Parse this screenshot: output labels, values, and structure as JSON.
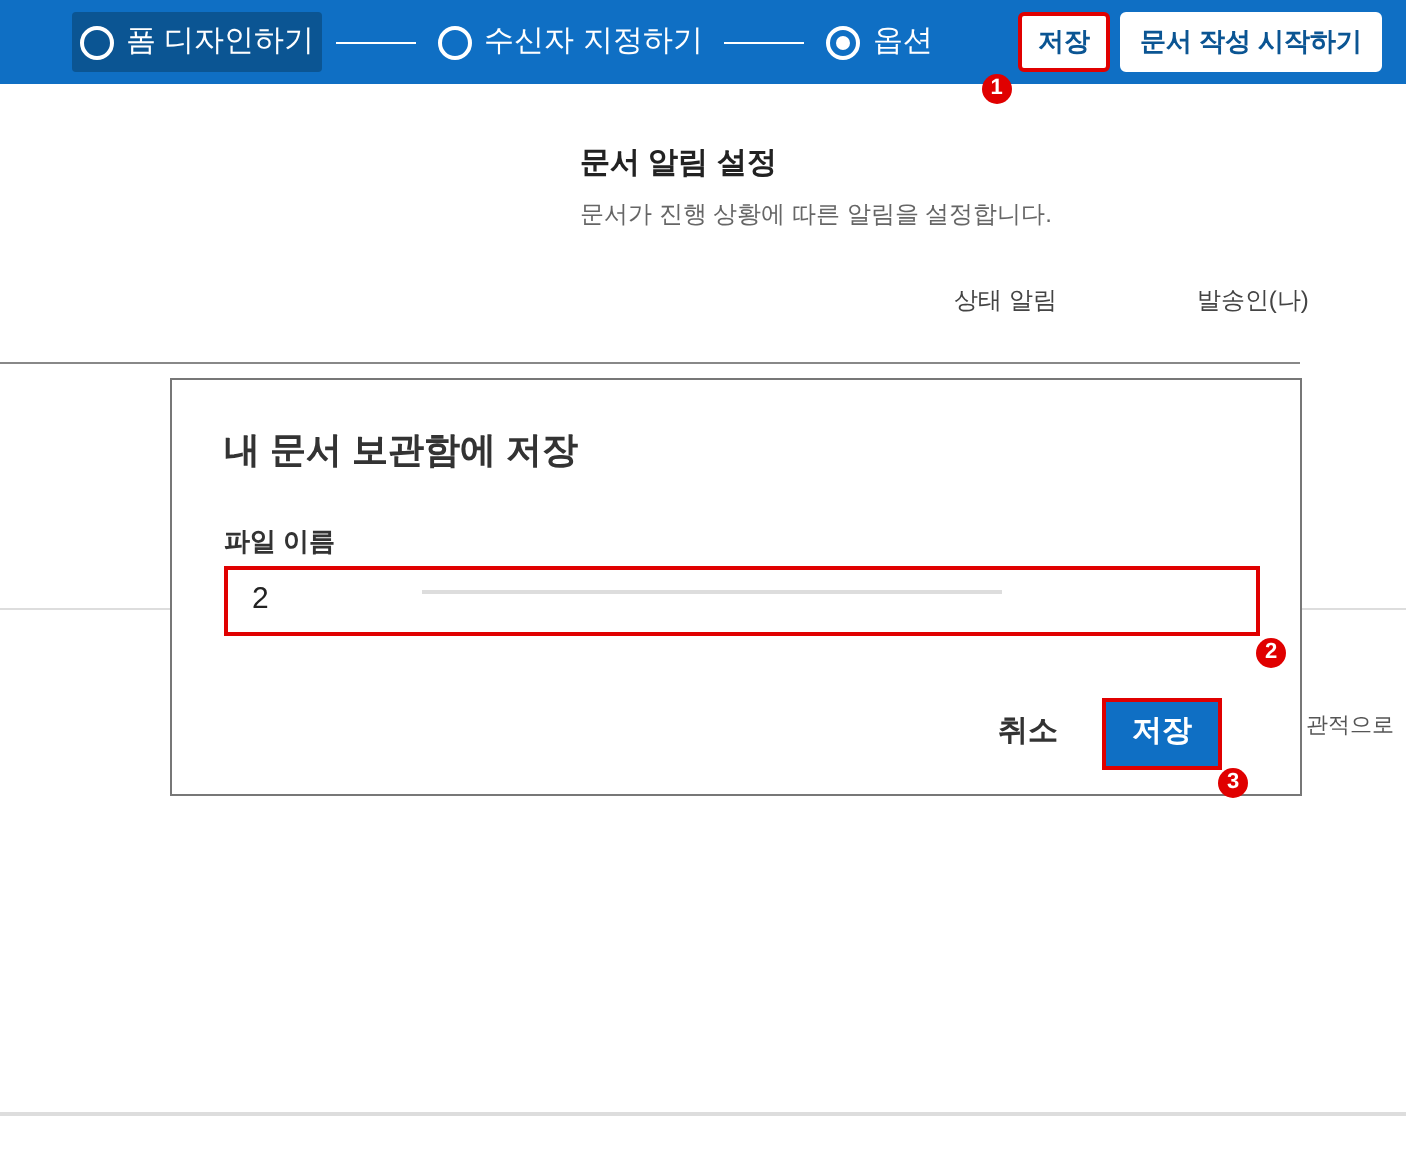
{
  "steps": [
    {
      "label": "폼 디자인하기",
      "checked": false,
      "highlighted": true
    },
    {
      "label": "수신자 지정하기",
      "checked": false,
      "highlighted": false
    },
    {
      "label": "옵션",
      "checked": true,
      "highlighted": false
    }
  ],
  "header_buttons": [
    {
      "label": "저장",
      "annotated": true,
      "badge": "1"
    },
    {
      "label": "문서 작성 시작하기",
      "annotated": false
    }
  ],
  "section": {
    "title": "문서 알림 설정",
    "subtitle": "문서가 진행 상황에 따른 알림을 설정합니다.",
    "columns": [
      "상태 알림",
      "발송인(나)"
    ],
    "partial_text": "관적으로"
  },
  "dialog": {
    "title": "내 문서 보관함에 저장",
    "field_label": "파일 이름",
    "field_value": "2",
    "field_annotated": true,
    "field_badge": "2",
    "buttons": [
      {
        "label": "취소",
        "kind": "text",
        "annotated": false
      },
      {
        "label": "저장",
        "kind": "primary",
        "annotated": true,
        "badge": "3"
      }
    ]
  }
}
